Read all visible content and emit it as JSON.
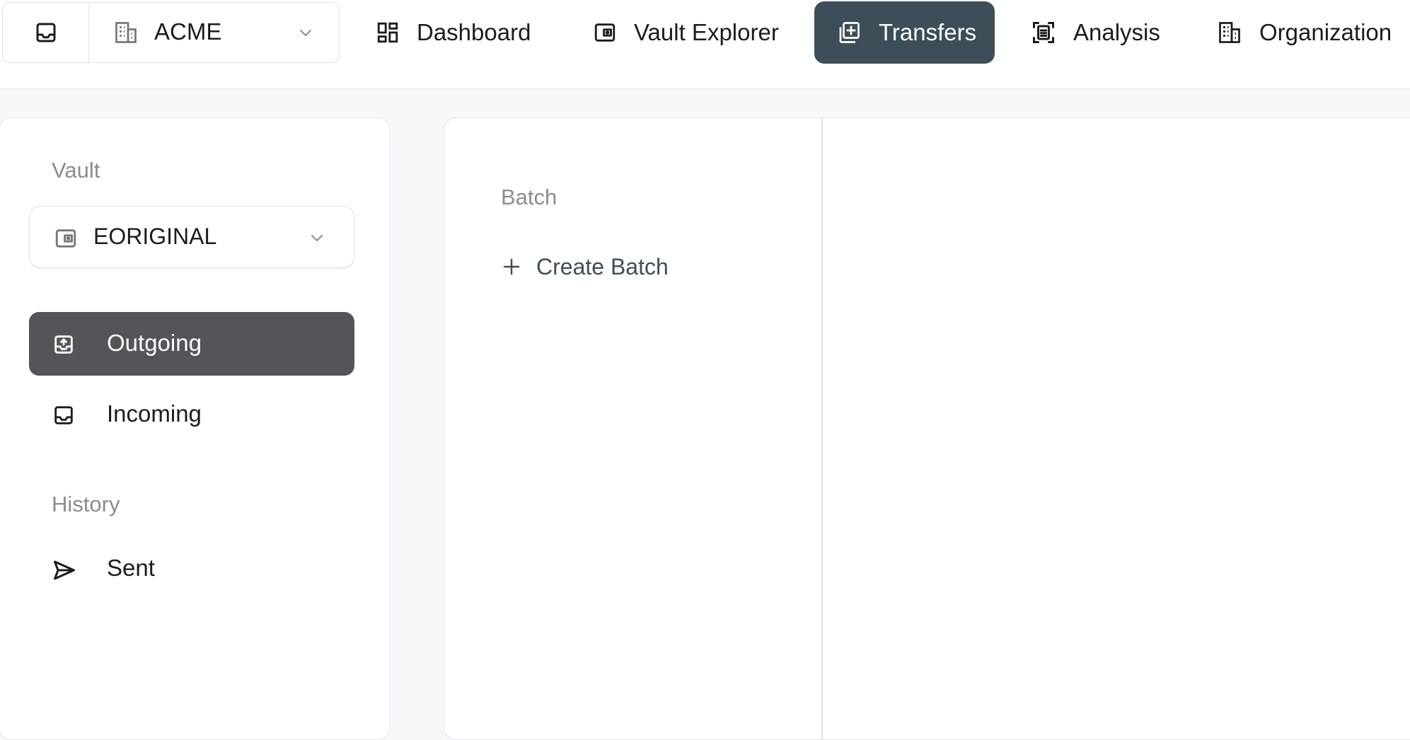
{
  "topbar": {
    "org_name": "ACME",
    "tabs": [
      {
        "label": "Dashboard",
        "icon": "dashboard-icon"
      },
      {
        "label": "Vault Explorer",
        "icon": "wallet-icon"
      },
      {
        "label": "Transfers",
        "icon": "transfers-icon",
        "active": true
      },
      {
        "label": "Analysis",
        "icon": "analysis-icon"
      },
      {
        "label": "Organization",
        "icon": "building-icon"
      }
    ]
  },
  "sidebar": {
    "vault_label": "Vault",
    "vault_selected": "EORIGINAL",
    "items": [
      {
        "label": "Outgoing",
        "icon": "outbox-icon",
        "active": true
      },
      {
        "label": "Incoming",
        "icon": "inbox-icon"
      }
    ],
    "history_label": "History",
    "history_items": [
      {
        "label": "Sent",
        "icon": "send-icon"
      }
    ]
  },
  "main": {
    "batch_label": "Batch",
    "create_batch_label": "Create Batch"
  },
  "colors": {
    "active_tab_bg": "#3e4e58",
    "active_sidebar_bg": "#545459",
    "muted_label": "#8c8c91",
    "page_bg": "#f7f8fa",
    "border": "#e1e4e8"
  }
}
